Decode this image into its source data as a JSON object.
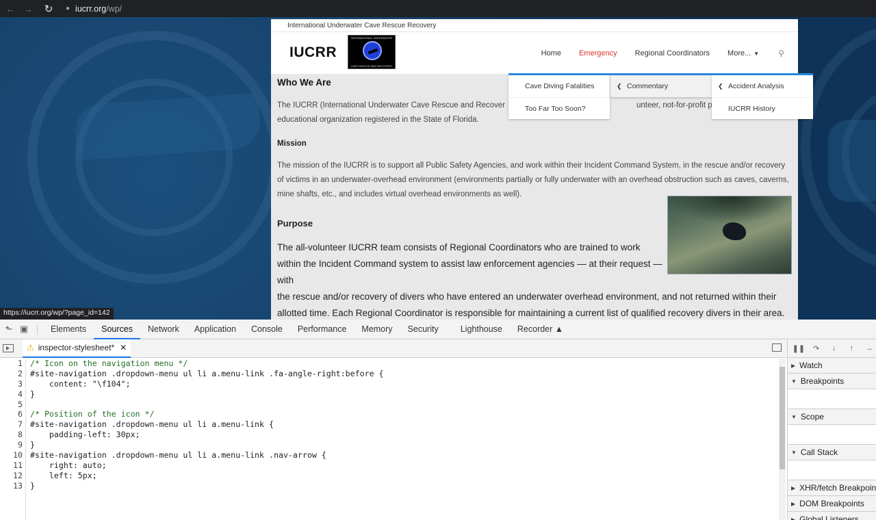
{
  "browser": {
    "url_host": "iucrr.org",
    "url_path": "/wp/"
  },
  "site": {
    "tagline": "International Underwater Cave Rescue Recovery",
    "logo_text": "IUCRR",
    "logo_badge_top": "INTERNATIONAL UNDERWATER",
    "logo_badge_bottom": "CAVE RESCUE AND RECOVERY",
    "nav": [
      {
        "label": "Home"
      },
      {
        "label": "Emergency"
      },
      {
        "label": "Regional Coordinators"
      },
      {
        "label": "More..."
      }
    ],
    "heading_who": "Who We Are",
    "intro_left": "The IUCRR (International Underwater Cave Rescue and Recover",
    "intro_right": "unteer, not-for-profit public",
    "intro_line2": "educational organization registered in the State of Florida.",
    "heading_mission": "Mission",
    "mission_text": "The mission of the IUCRR is to support all Public Safety Agencies, and work within their Incident Command System, in the rescue and/or recovery of victims in an underwater-overhead environment (environments partially or fully underwater with an overhead obstruction such as caves, caverns, mine shafts, etc., and includes virtual overhead environments as well).",
    "heading_purpose": "Purpose",
    "purpose_line1": "The all-volunteer IUCRR team consists of Regional Coordinators who are trained to work within the Incident Command system to assist law enforcement agencies — at their request — with",
    "purpose_line2": "the rescue and/or recovery of divers who have entered an underwater overhead environment, and not returned within their allotted time. Each Regional Coordinator is responsible for maintaining a current list of qualified recovery divers in their area."
  },
  "dropdown": {
    "col1": [
      "Cave Diving Fatalities",
      "Too Far Too Soon?"
    ],
    "col2": [
      "Commentary"
    ],
    "col3": [
      "Accident Analysis",
      "IUCRR History"
    ]
  },
  "status_url": "https://iucrr.org/wp/?page_id=142",
  "devtools": {
    "tabs": [
      "Elements",
      "Sources",
      "Network",
      "Application",
      "Console",
      "Performance",
      "Memory",
      "Security",
      "Lighthouse",
      "Recorder"
    ],
    "active_tab": "Sources",
    "file_tab": "inspector-stylesheet*",
    "code_lines": [
      "/* Icon on the navigation menu */",
      "#site-navigation .dropdown-menu ul li a.menu-link .fa-angle-right:before {",
      "    content: \"\\f104\";",
      "}",
      "",
      "/* Position of the icon */",
      "#site-navigation .dropdown-menu ul li a.menu-link {",
      "    padding-left: 30px;",
      "}",
      "#site-navigation .dropdown-menu ul li a.menu-link .nav-arrow {",
      "    right: auto;",
      "    left: 5px;",
      "}"
    ],
    "debugger_sections": [
      "Watch",
      "Breakpoints",
      "Scope",
      "Call Stack",
      "XHR/fetch Breakpoints",
      "DOM Breakpoints",
      "Global Listeners"
    ]
  },
  "colors": {
    "accent_blue": "#1a73e8",
    "emergency_red": "#d9362b",
    "dropdown_bar": "#2a8adf"
  }
}
